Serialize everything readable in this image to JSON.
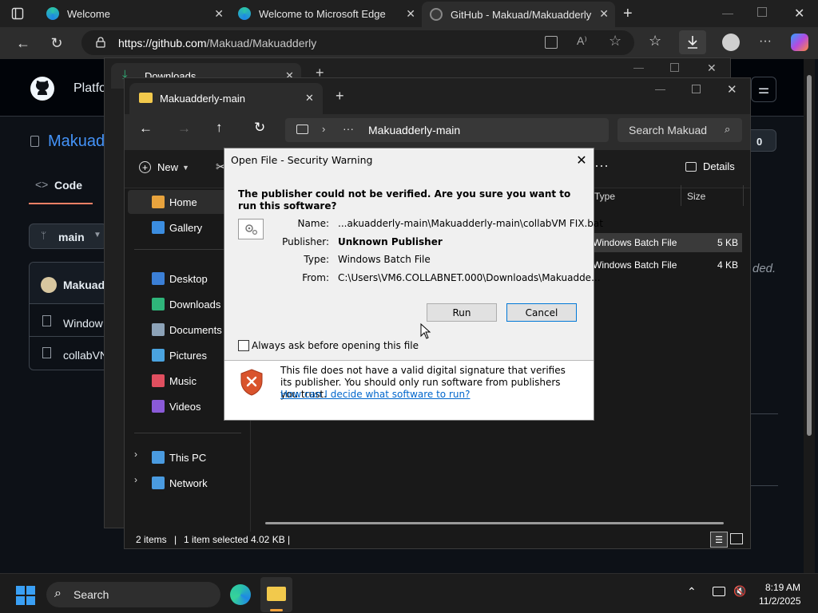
{
  "browser": {
    "tabs": [
      {
        "label": "Welcome",
        "active": false
      },
      {
        "label": "Welcome to Microsoft Edge",
        "active": false
      },
      {
        "label": "GitHub - Makuad/Makuadderly",
        "active": true
      }
    ],
    "url_host": "https://github.com",
    "url_path": "/Makuad/Makuadderly"
  },
  "github": {
    "header_text": "Platfo",
    "repo_owner": "Makuad",
    "code_tab": "Code",
    "branch": "main",
    "files": [
      "Makuad",
      "Window",
      "collabVN"
    ],
    "counter": "0",
    "faded_note": "ded."
  },
  "downloads_window": {
    "tab_label": "Downloads"
  },
  "explorer": {
    "tab_label": "Makuadderly-main",
    "breadcrumb": "Makuadderly-main",
    "search_placeholder": "Search Makuad",
    "new_label": "New",
    "details_label": "Details",
    "columns": {
      "type": "Type",
      "size": "Size"
    },
    "sidebar": [
      {
        "label": "Home",
        "icon": "home-icon",
        "color": "#e8a33d"
      },
      {
        "label": "Gallery",
        "icon": "gallery-icon",
        "color": "#3b8de0"
      },
      {
        "label": "Desktop",
        "icon": "desktop-icon",
        "color": "#3b7fd6"
      },
      {
        "label": "Downloads",
        "icon": "downloads-icon",
        "color": "#2fb57a"
      },
      {
        "label": "Documents",
        "icon": "documents-icon",
        "color": "#8da3b8"
      },
      {
        "label": "Pictures",
        "icon": "pictures-icon",
        "color": "#4aa3df"
      },
      {
        "label": "Music",
        "icon": "music-icon",
        "color": "#e04f5f"
      },
      {
        "label": "Videos",
        "icon": "videos-icon",
        "color": "#8a5ad8"
      },
      {
        "label": "This PC",
        "icon": "pc-icon",
        "color": "#4a9be0"
      },
      {
        "label": "Network",
        "icon": "network-icon",
        "color": "#4a9be0"
      }
    ],
    "files": [
      {
        "type": "Windows Batch File",
        "size": "5 KB"
      },
      {
        "type": "Windows Batch File",
        "size": "4 KB"
      }
    ],
    "status": {
      "items": "2 items",
      "selected": "1 item selected",
      "size": "4.02 KB",
      "sep": "|"
    }
  },
  "dialog": {
    "title": "Open File - Security Warning",
    "question": "The publisher could not be verified.  Are you sure you want to run this software?",
    "name_label": "Name:",
    "name_value": "...akuadderly-main\\Makuadderly-main\\collabVM FIX.bat",
    "publisher_label": "Publisher:",
    "publisher_value": "Unknown Publisher",
    "type_label": "Type:",
    "type_value": "Windows Batch File",
    "from_label": "From:",
    "from_value": "C:\\Users\\VM6.COLLABNET.000\\Downloads\\Makuadde...",
    "run_label": "Run",
    "cancel_label": "Cancel",
    "checkbox_label": "Always ask before opening this file",
    "warning_text": "This file does not have a valid digital signature that verifies its publisher.  You should only run software from publishers you trust.",
    "link_text": "How can I decide what software to run?"
  },
  "taskbar": {
    "search_label": "Search",
    "time": "8:19 AM",
    "date": "11/2/2025"
  }
}
